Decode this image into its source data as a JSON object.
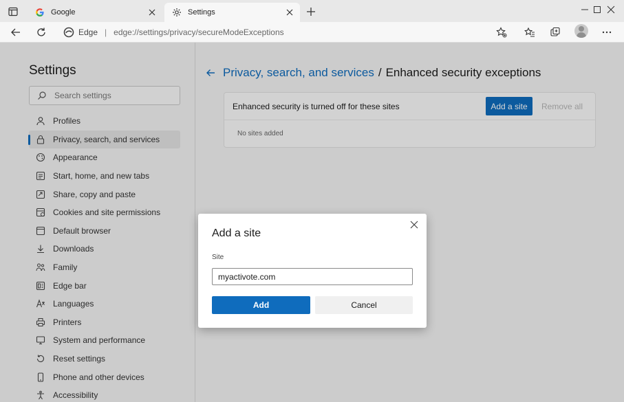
{
  "tabs": [
    {
      "title": "Google",
      "icon": "google-g-icon"
    },
    {
      "title": "Settings",
      "icon": "gear-icon"
    }
  ],
  "address_bar": {
    "site_name": "Edge",
    "url": "edge://settings/privacy/secureModeExceptions"
  },
  "sidebar": {
    "title": "Settings",
    "search_placeholder": "Search settings",
    "items": [
      {
        "label": "Profiles",
        "icon": "profile-icon"
      },
      {
        "label": "Privacy, search, and services",
        "icon": "lock-icon",
        "selected": true
      },
      {
        "label": "Appearance",
        "icon": "appearance-icon"
      },
      {
        "label": "Start, home, and new tabs",
        "icon": "start-home-icon"
      },
      {
        "label": "Share, copy and paste",
        "icon": "share-icon"
      },
      {
        "label": "Cookies and site permissions",
        "icon": "cookies-icon"
      },
      {
        "label": "Default browser",
        "icon": "default-browser-icon"
      },
      {
        "label": "Downloads",
        "icon": "download-icon"
      },
      {
        "label": "Family",
        "icon": "family-icon"
      },
      {
        "label": "Edge bar",
        "icon": "edge-bar-icon"
      },
      {
        "label": "Languages",
        "icon": "languages-icon"
      },
      {
        "label": "Printers",
        "icon": "printer-icon"
      },
      {
        "label": "System and performance",
        "icon": "system-icon"
      },
      {
        "label": "Reset settings",
        "icon": "reset-icon"
      },
      {
        "label": "Phone and other devices",
        "icon": "phone-icon"
      },
      {
        "label": "Accessibility",
        "icon": "accessibility-icon"
      }
    ]
  },
  "main": {
    "breadcrumb_link": "Privacy, search, and services",
    "breadcrumb_separator": "/",
    "breadcrumb_current": "Enhanced security exceptions",
    "card_text": "Enhanced security is turned off for these sites",
    "add_site_label": "Add a site",
    "remove_all_label": "Remove all",
    "empty_text": "No sites added"
  },
  "dialog": {
    "title": "Add a site",
    "field_label": "Site",
    "field_value": "myactivote.com",
    "add_label": "Add",
    "cancel_label": "Cancel"
  },
  "colors": {
    "accent": "#0f6cbd",
    "page_bg": "#f3f3f3"
  }
}
